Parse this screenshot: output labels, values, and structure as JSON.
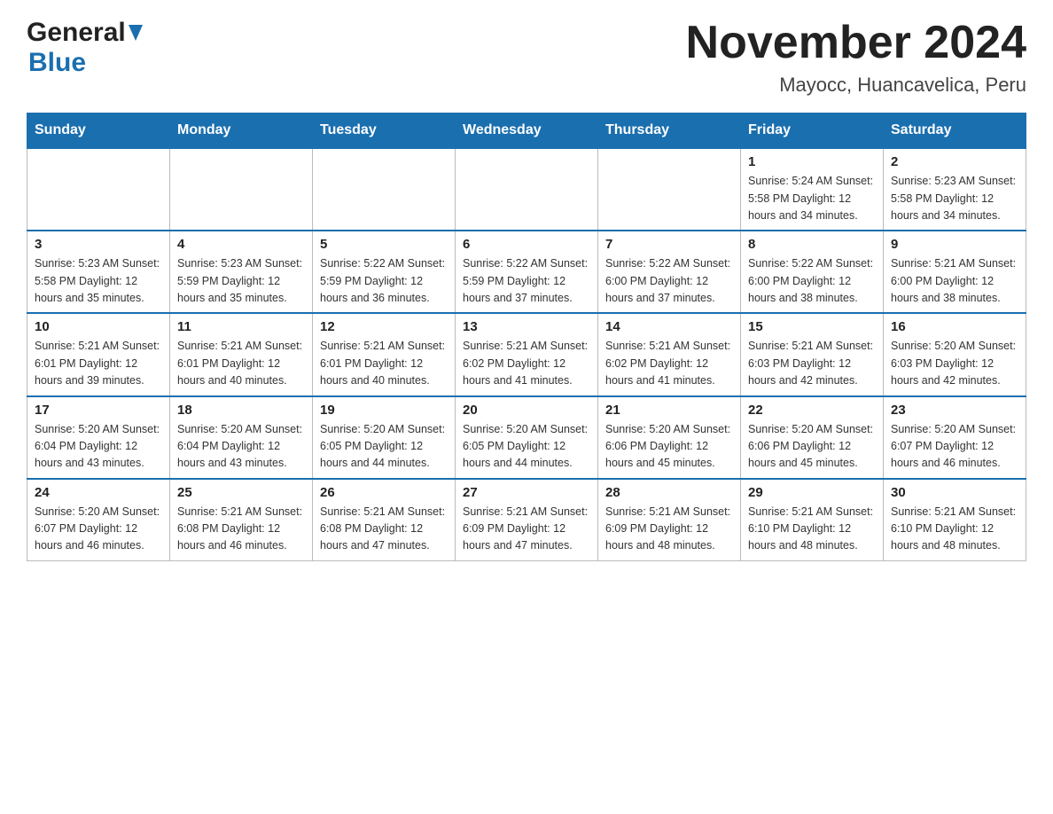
{
  "header": {
    "logo_general": "General",
    "logo_blue": "Blue",
    "title": "November 2024",
    "subtitle": "Mayocc, Huancavelica, Peru"
  },
  "calendar": {
    "days_of_week": [
      "Sunday",
      "Monday",
      "Tuesday",
      "Wednesday",
      "Thursday",
      "Friday",
      "Saturday"
    ],
    "weeks": [
      {
        "days": [
          {
            "number": "",
            "info": ""
          },
          {
            "number": "",
            "info": ""
          },
          {
            "number": "",
            "info": ""
          },
          {
            "number": "",
            "info": ""
          },
          {
            "number": "",
            "info": ""
          },
          {
            "number": "1",
            "info": "Sunrise: 5:24 AM\nSunset: 5:58 PM\nDaylight: 12 hours and 34 minutes."
          },
          {
            "number": "2",
            "info": "Sunrise: 5:23 AM\nSunset: 5:58 PM\nDaylight: 12 hours and 34 minutes."
          }
        ]
      },
      {
        "days": [
          {
            "number": "3",
            "info": "Sunrise: 5:23 AM\nSunset: 5:58 PM\nDaylight: 12 hours and 35 minutes."
          },
          {
            "number": "4",
            "info": "Sunrise: 5:23 AM\nSunset: 5:59 PM\nDaylight: 12 hours and 35 minutes."
          },
          {
            "number": "5",
            "info": "Sunrise: 5:22 AM\nSunset: 5:59 PM\nDaylight: 12 hours and 36 minutes."
          },
          {
            "number": "6",
            "info": "Sunrise: 5:22 AM\nSunset: 5:59 PM\nDaylight: 12 hours and 37 minutes."
          },
          {
            "number": "7",
            "info": "Sunrise: 5:22 AM\nSunset: 6:00 PM\nDaylight: 12 hours and 37 minutes."
          },
          {
            "number": "8",
            "info": "Sunrise: 5:22 AM\nSunset: 6:00 PM\nDaylight: 12 hours and 38 minutes."
          },
          {
            "number": "9",
            "info": "Sunrise: 5:21 AM\nSunset: 6:00 PM\nDaylight: 12 hours and 38 minutes."
          }
        ]
      },
      {
        "days": [
          {
            "number": "10",
            "info": "Sunrise: 5:21 AM\nSunset: 6:01 PM\nDaylight: 12 hours and 39 minutes."
          },
          {
            "number": "11",
            "info": "Sunrise: 5:21 AM\nSunset: 6:01 PM\nDaylight: 12 hours and 40 minutes."
          },
          {
            "number": "12",
            "info": "Sunrise: 5:21 AM\nSunset: 6:01 PM\nDaylight: 12 hours and 40 minutes."
          },
          {
            "number": "13",
            "info": "Sunrise: 5:21 AM\nSunset: 6:02 PM\nDaylight: 12 hours and 41 minutes."
          },
          {
            "number": "14",
            "info": "Sunrise: 5:21 AM\nSunset: 6:02 PM\nDaylight: 12 hours and 41 minutes."
          },
          {
            "number": "15",
            "info": "Sunrise: 5:21 AM\nSunset: 6:03 PM\nDaylight: 12 hours and 42 minutes."
          },
          {
            "number": "16",
            "info": "Sunrise: 5:20 AM\nSunset: 6:03 PM\nDaylight: 12 hours and 42 minutes."
          }
        ]
      },
      {
        "days": [
          {
            "number": "17",
            "info": "Sunrise: 5:20 AM\nSunset: 6:04 PM\nDaylight: 12 hours and 43 minutes."
          },
          {
            "number": "18",
            "info": "Sunrise: 5:20 AM\nSunset: 6:04 PM\nDaylight: 12 hours and 43 minutes."
          },
          {
            "number": "19",
            "info": "Sunrise: 5:20 AM\nSunset: 6:05 PM\nDaylight: 12 hours and 44 minutes."
          },
          {
            "number": "20",
            "info": "Sunrise: 5:20 AM\nSunset: 6:05 PM\nDaylight: 12 hours and 44 minutes."
          },
          {
            "number": "21",
            "info": "Sunrise: 5:20 AM\nSunset: 6:06 PM\nDaylight: 12 hours and 45 minutes."
          },
          {
            "number": "22",
            "info": "Sunrise: 5:20 AM\nSunset: 6:06 PM\nDaylight: 12 hours and 45 minutes."
          },
          {
            "number": "23",
            "info": "Sunrise: 5:20 AM\nSunset: 6:07 PM\nDaylight: 12 hours and 46 minutes."
          }
        ]
      },
      {
        "days": [
          {
            "number": "24",
            "info": "Sunrise: 5:20 AM\nSunset: 6:07 PM\nDaylight: 12 hours and 46 minutes."
          },
          {
            "number": "25",
            "info": "Sunrise: 5:21 AM\nSunset: 6:08 PM\nDaylight: 12 hours and 46 minutes."
          },
          {
            "number": "26",
            "info": "Sunrise: 5:21 AM\nSunset: 6:08 PM\nDaylight: 12 hours and 47 minutes."
          },
          {
            "number": "27",
            "info": "Sunrise: 5:21 AM\nSunset: 6:09 PM\nDaylight: 12 hours and 47 minutes."
          },
          {
            "number": "28",
            "info": "Sunrise: 5:21 AM\nSunset: 6:09 PM\nDaylight: 12 hours and 48 minutes."
          },
          {
            "number": "29",
            "info": "Sunrise: 5:21 AM\nSunset: 6:10 PM\nDaylight: 12 hours and 48 minutes."
          },
          {
            "number": "30",
            "info": "Sunrise: 5:21 AM\nSunset: 6:10 PM\nDaylight: 12 hours and 48 minutes."
          }
        ]
      }
    ]
  }
}
